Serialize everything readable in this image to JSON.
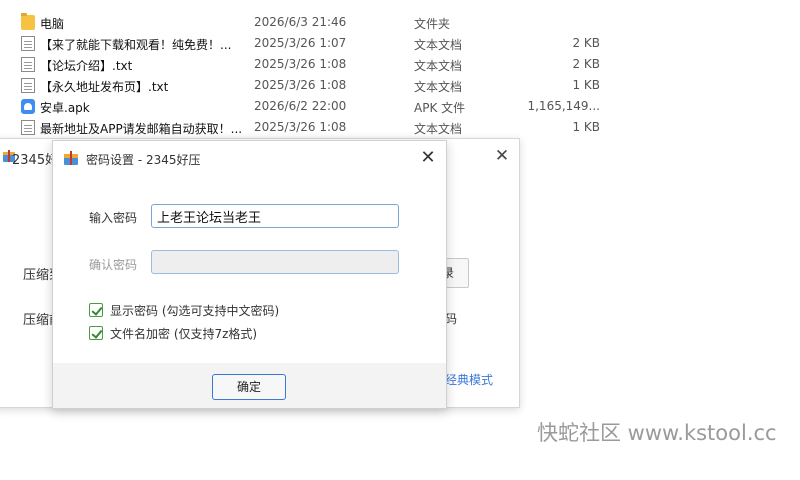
{
  "files": [
    {
      "icon": "folder-icon",
      "name": "电脑",
      "date": "2026/6/3 21:46",
      "type": "文件夹",
      "size": ""
    },
    {
      "icon": "txt-file-icon",
      "name": "【来了就能下载和观看！纯免费！...",
      "date": "2025/3/26 1:07",
      "type": "文本文档",
      "size": "2 KB"
    },
    {
      "icon": "txt-file-icon",
      "name": "【论坛介绍】.txt",
      "date": "2025/3/26 1:08",
      "type": "文本文档",
      "size": "2 KB"
    },
    {
      "icon": "txt-file-icon",
      "name": "【永久地址发布页】.txt",
      "date": "2025/3/26 1:08",
      "type": "文本文档",
      "size": "1 KB"
    },
    {
      "icon": "apk-file-icon",
      "name": "安卓.apk",
      "date": "2026/6/2 22:00",
      "type": "APK 文件",
      "size": "1,165,149..."
    },
    {
      "icon": "txt-file-icon",
      "name": "最新地址及APP请发邮箱自动获取！...",
      "date": "2025/3/26 1:08",
      "type": "文本文档",
      "size": "1 KB"
    }
  ],
  "back_window": {
    "title": "2345好",
    "close_icon": "close-icon",
    "left_label_1": "压缩到",
    "left_label_2": "压缩前",
    "button_fragment": "录",
    "right_label_2": "码",
    "classic_link": "经典模式"
  },
  "dialog": {
    "title": "密码设置 - 2345好压",
    "password_label": "输入密码",
    "password_value": "上老王论坛当老王",
    "confirm_label": "确认密码",
    "confirm_value": "",
    "show_password_label": "显示密码 (勾选可支持中文密码)",
    "show_password_checked": true,
    "encrypt_names_label": "文件名加密 (仅支持7z格式)",
    "encrypt_names_checked": true,
    "ok_label": "确定"
  },
  "watermark": "快蛇社区 www.kstool.cc"
}
